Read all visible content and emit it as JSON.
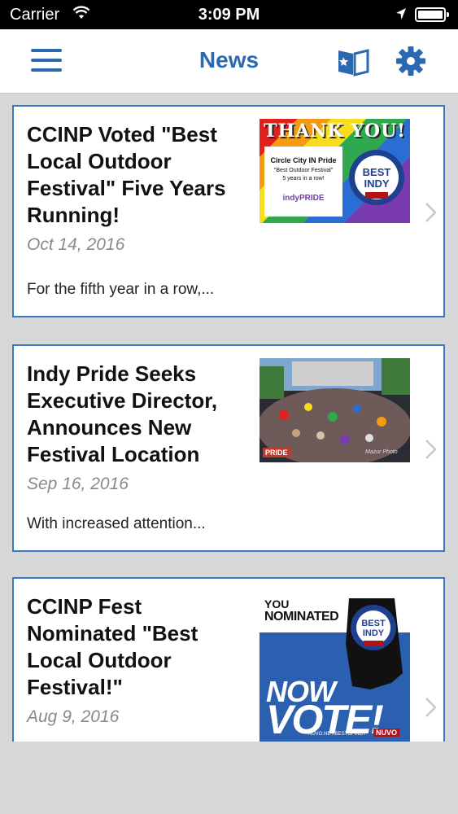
{
  "status_bar": {
    "carrier": "Carrier",
    "time": "3:09 PM"
  },
  "nav": {
    "title": "News",
    "menu_icon": "menu-icon",
    "bookmark_icon": "bookmark-icon",
    "settings_icon": "gear-icon"
  },
  "colors": {
    "accent": "#2a69b0",
    "card_border": "#3b78bd",
    "background": "#d6d7d9"
  },
  "articles": [
    {
      "title": "CCINP Voted \"Best Local Outdoor Festival\" Five Years Running!",
      "date": "Oct 14, 2016",
      "excerpt": "For the fifth year in a row,...",
      "thumb": {
        "banner": "THANK YOU!",
        "line1": "Circle City IN Pride",
        "line2": "\"Best Outdoor Festival\"",
        "line3": "5 years in a row!",
        "logo": "indyPRIDE"
      }
    },
    {
      "title": "Indy Pride Seeks Executive Director, Announces New Festival Location",
      "date": "Sep 16, 2016",
      "excerpt": "With increased attention...",
      "thumb": {
        "badge": "PRIDE",
        "credit": "Mazur Photo"
      }
    },
    {
      "title": "CCINP Fest Nominated \"Best Local Outdoor Festival!\"",
      "date": "Aug 9, 2016",
      "thumb": {
        "you": "YOU",
        "nominated": "NOMINATED",
        "now": "NOW",
        "vote": "VOTE!",
        "url": "NUVO.NET/BESTOFINDY",
        "nuvo": "NUVO"
      }
    }
  ]
}
